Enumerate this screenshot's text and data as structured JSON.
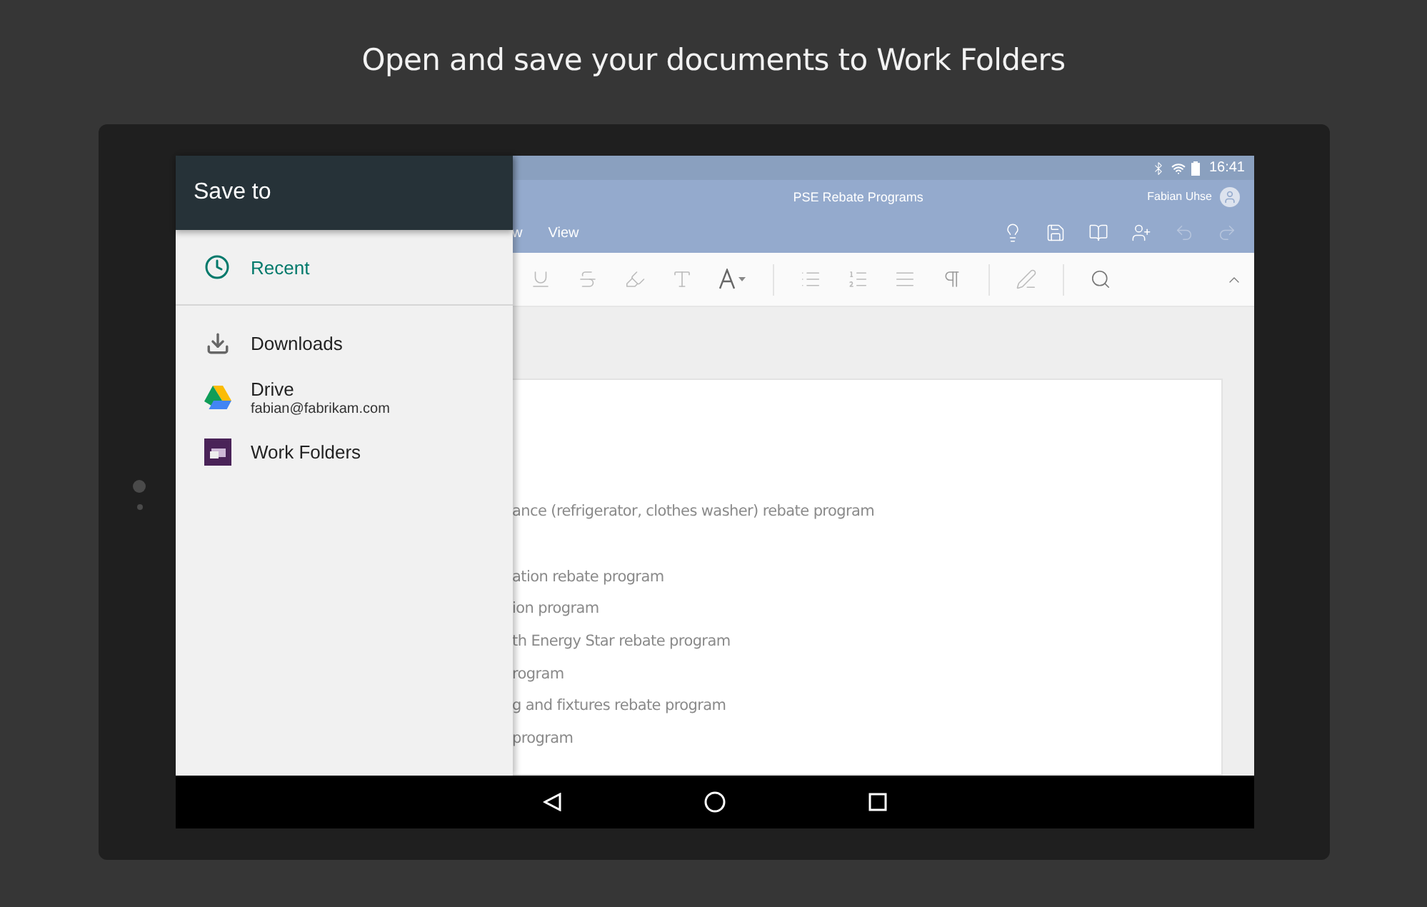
{
  "headline": "Open and save your documents to Work Folders",
  "status_bar": {
    "time": "16:41"
  },
  "document": {
    "title": "PSE Rebate Programs",
    "user": "Fabian Uhse"
  },
  "ribbon_tabs": [
    "w",
    "View"
  ],
  "document_lines": [
    "ance (refrigerator, clothes washer) rebate program",
    "ation rebate program",
    "ion program",
    "th Energy Star rebate program",
    "rogram",
    "g and fixtures rebate program",
    "program"
  ],
  "drawer": {
    "title": "Save to",
    "sections": [
      [
        {
          "kind": "recent",
          "label": "Recent",
          "selected": true
        }
      ],
      [
        {
          "kind": "downloads",
          "label": "Downloads",
          "selected": false
        },
        {
          "kind": "drive",
          "label": "Drive",
          "account": "fabian@fabrikam.com",
          "selected": false
        },
        {
          "kind": "workfolders",
          "label": "Work Folders",
          "selected": false
        }
      ]
    ]
  }
}
